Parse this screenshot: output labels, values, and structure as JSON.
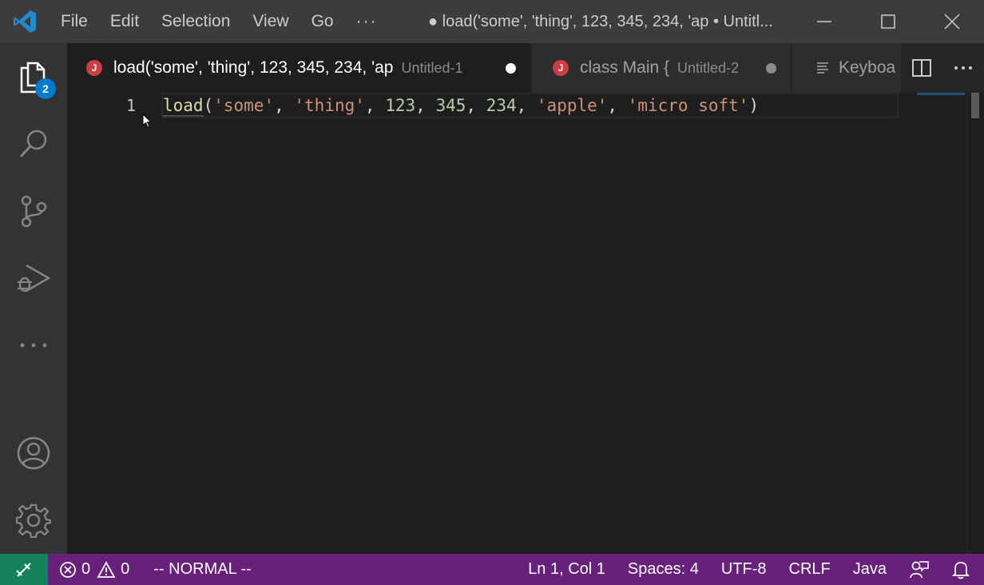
{
  "menu": {
    "items": [
      "File",
      "Edit",
      "Selection",
      "View",
      "Go"
    ],
    "more": "···"
  },
  "window": {
    "title": "● load('some', 'thing', 123, 345, 234, 'ap • Untitl..."
  },
  "activity_bar": {
    "explorer_badge": "2"
  },
  "tabs": [
    {
      "label": "load('some', 'thing', 123, 345, 234, 'ap",
      "description": "Untitled-1",
      "icon": "J",
      "active": true
    },
    {
      "label": "class Main {",
      "description": "Untitled-2",
      "icon": "J",
      "active": false
    },
    {
      "label": "Keyboa",
      "description": "",
      "icon": "preview-icon",
      "active": false
    }
  ],
  "editor": {
    "line_number": "1",
    "code": {
      "fn": "load",
      "open": "(",
      "s1": "'some'",
      "c1": ", ",
      "s2": "'thing'",
      "c2": ", ",
      "n1": "123",
      "c3": ", ",
      "n2": "345",
      "c4": ", ",
      "n3": "234",
      "c5": ", ",
      "s3": "'apple'",
      "c6": ", ",
      "s4": "'micro soft'",
      "close": ")"
    }
  },
  "status_bar": {
    "errors": "0",
    "warnings": "0",
    "mode": "-- NORMAL --",
    "position": "Ln 1, Col 1",
    "spaces": "Spaces: 4",
    "encoding": "UTF-8",
    "eol": "CRLF",
    "language": "Java"
  },
  "colors": {
    "status_bar": "#68217a",
    "remote_indicator": "#16825d",
    "accent": "#007acc",
    "java_icon": "#cc3e44"
  }
}
